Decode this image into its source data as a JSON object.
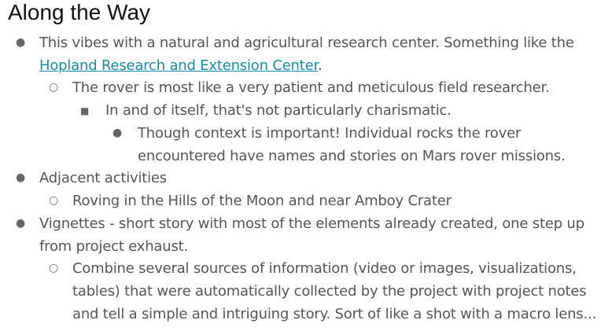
{
  "title": "Along the Way",
  "items": [
    {
      "bullet": "●",
      "text_before": "This vibes with a natural and agricultural research center. Something like the ",
      "link_text": "Hopland Research and Extension Center",
      "text_after": "."
    },
    {
      "bullet": "○",
      "text": "The rover is most like a very patient and meticulous field researcher."
    },
    {
      "bullet": "■",
      "text": "In and of itself, that's not particularly charismatic."
    },
    {
      "bullet": "●",
      "text": "Though context is important! Individual rocks the rover encountered have names and stories on Mars rover missions."
    },
    {
      "bullet": "●",
      "text": "Adjacent activities"
    },
    {
      "bullet": "○",
      "text": "Roving  in the Hills of the Moon and near Amboy Crater"
    },
    {
      "bullet": "●",
      "text": "Vignettes - short story with most of the elements already created, one step up from project exhaust."
    },
    {
      "bullet": "○",
      "text": "Combine several sources of information (video or images, visualizations, tables) that were automatically collected by the project with project notes and tell a simple and intriguing story. Sort of like a shot with a macro lens..."
    }
  ]
}
